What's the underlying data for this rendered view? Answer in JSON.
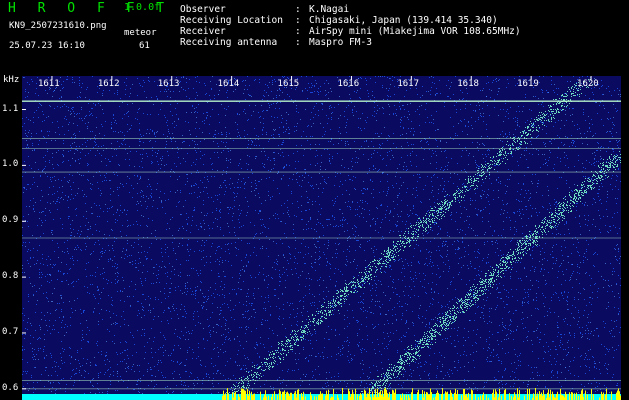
{
  "header": {
    "brand": "H R O F F T",
    "version": "1.0.0f",
    "filename": "KN9_2507231610.png",
    "mode_label": "meteor",
    "datetime": "25.07.23 16:10",
    "count": "61",
    "info": [
      {
        "label": "Observer",
        "value": "K.Nagai"
      },
      {
        "label": "Receiving Location",
        "value": "Chigasaki, Japan (139.414 35.340)"
      },
      {
        "label": "Receiver",
        "value": "AirSpy mini (Miakejima VOR 108.65MHz)"
      },
      {
        "label": "Receiving antenna",
        "value": "Maspro FM-3"
      }
    ],
    "separator": ":"
  },
  "chart_data": {
    "type": "heatmap",
    "ylabel": "kHz",
    "x_ticks": [
      "1611",
      "1612",
      "1613",
      "1614",
      "1615",
      "1616",
      "1617",
      "1618",
      "1619",
      "1620"
    ],
    "y_ticks": [
      {
        "value": 1.1,
        "label": "1.1"
      },
      {
        "value": 1.0,
        "label": "1.0"
      },
      {
        "value": 0.9,
        "label": "0.9"
      },
      {
        "value": 0.8,
        "label": "0.8"
      },
      {
        "value": 0.7,
        "label": "0.7"
      },
      {
        "value": 0.6,
        "label": "0.6"
      }
    ],
    "ylim": [
      0.58,
      1.16
    ],
    "xlim": [
      1610.5,
      1620.5
    ],
    "carriers_khz": [
      1.115,
      1.048,
      1.03,
      0.988,
      0.87,
      0.615,
      0.6
    ],
    "drift_traces": [
      {
        "start": [
          1613.9,
          0.58
        ],
        "end": [
          1619.9,
          1.15
        ]
      },
      {
        "start": [
          1616.2,
          0.58
        ],
        "end": [
          1620.5,
          1.02
        ]
      }
    ],
    "colors": {
      "background": "#0a0a60",
      "noise": "#1e5cff",
      "signal": "#7fffd0",
      "carrier": "#bfffd0",
      "yellow": "#ffff00",
      "cyan": "#00ffff"
    }
  }
}
